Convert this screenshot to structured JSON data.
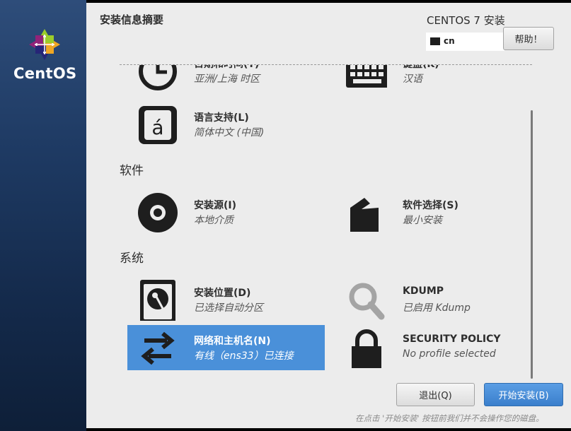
{
  "sidebar": {
    "logo_text": "CentOS"
  },
  "header": {
    "title": "安装信息摘要",
    "product": "CENTOS 7 安装",
    "keyboard_layout": "cn",
    "help_label": "帮助！"
  },
  "sections": {
    "software": "软件",
    "system": "系统"
  },
  "spokes": {
    "datetime": {
      "title": "日期和时间(T)",
      "status": "亚洲/上海 时区",
      "icon": "clock-icon"
    },
    "keyboard": {
      "title": "键盘(K)",
      "status": "汉语",
      "icon": "keyboard-icon"
    },
    "language": {
      "title": "语言支持(L)",
      "status": "简体中文 (中国)",
      "icon": "language-icon"
    },
    "source": {
      "title": "安装源(I)",
      "status": "本地介质",
      "icon": "disc-icon"
    },
    "software": {
      "title": "软件选择(S)",
      "status": "最小安装",
      "icon": "package-icon"
    },
    "destination": {
      "title": "安装位置(D)",
      "status": "已选择自动分区",
      "icon": "harddisk-icon"
    },
    "kdump": {
      "title": "KDUMP",
      "status": "已启用 Kdump",
      "icon": "search-icon"
    },
    "network": {
      "title": "网络和主机名(N)",
      "status": "有线（ens33）已连接",
      "icon": "network-arrows-icon"
    },
    "security": {
      "title": "SECURITY POLICY",
      "status": "No profile selected",
      "icon": "lock-icon"
    }
  },
  "buttons": {
    "quit": "退出(Q)",
    "begin": "开始安装(B)"
  },
  "footer_note": "在点击 '开始安装' 按钮前我们并不会操作您的磁盘。",
  "colors": {
    "sidebar": "#1e3a63",
    "selected": "#4a90d9",
    "primary": "#3a7fcc",
    "background": "#ececec"
  }
}
